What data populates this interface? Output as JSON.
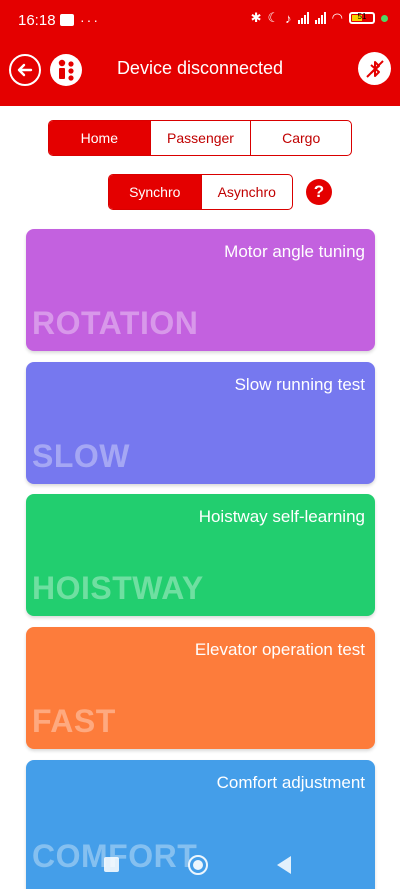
{
  "status_bar": {
    "time": "16:18",
    "battery_level": "51"
  },
  "app_bar": {
    "title": "Device disconnected"
  },
  "type_tabs": [
    {
      "label": "Home",
      "active": true
    },
    {
      "label": "Passenger",
      "active": false
    },
    {
      "label": "Cargo",
      "active": false
    }
  ],
  "mode_tabs": [
    {
      "label": "Synchro",
      "active": true
    },
    {
      "label": "Asynchro",
      "active": false
    }
  ],
  "help": {
    "label": "?"
  },
  "cards": [
    {
      "subtitle": "Motor angle tuning",
      "label": "ROTATION",
      "color": "#c361df"
    },
    {
      "subtitle": "Slow running test",
      "label": "SLOW",
      "color": "#7678ef"
    },
    {
      "subtitle": "Hoistway self-learning",
      "label": "HOISTWAY",
      "color": "#22ce6f"
    },
    {
      "subtitle": "Elevator operation test",
      "label": "FAST",
      "color": "#fd7c3b"
    },
    {
      "subtitle": "Comfort adjustment",
      "label": "COMFORT",
      "color": "#449ee9"
    }
  ],
  "theme": {
    "accent": "#e40000"
  },
  "icons": {
    "back": "back-arrow-icon",
    "info": "vertical-dots-icon",
    "bluetooth": "bluetooth-disabled-icon"
  }
}
